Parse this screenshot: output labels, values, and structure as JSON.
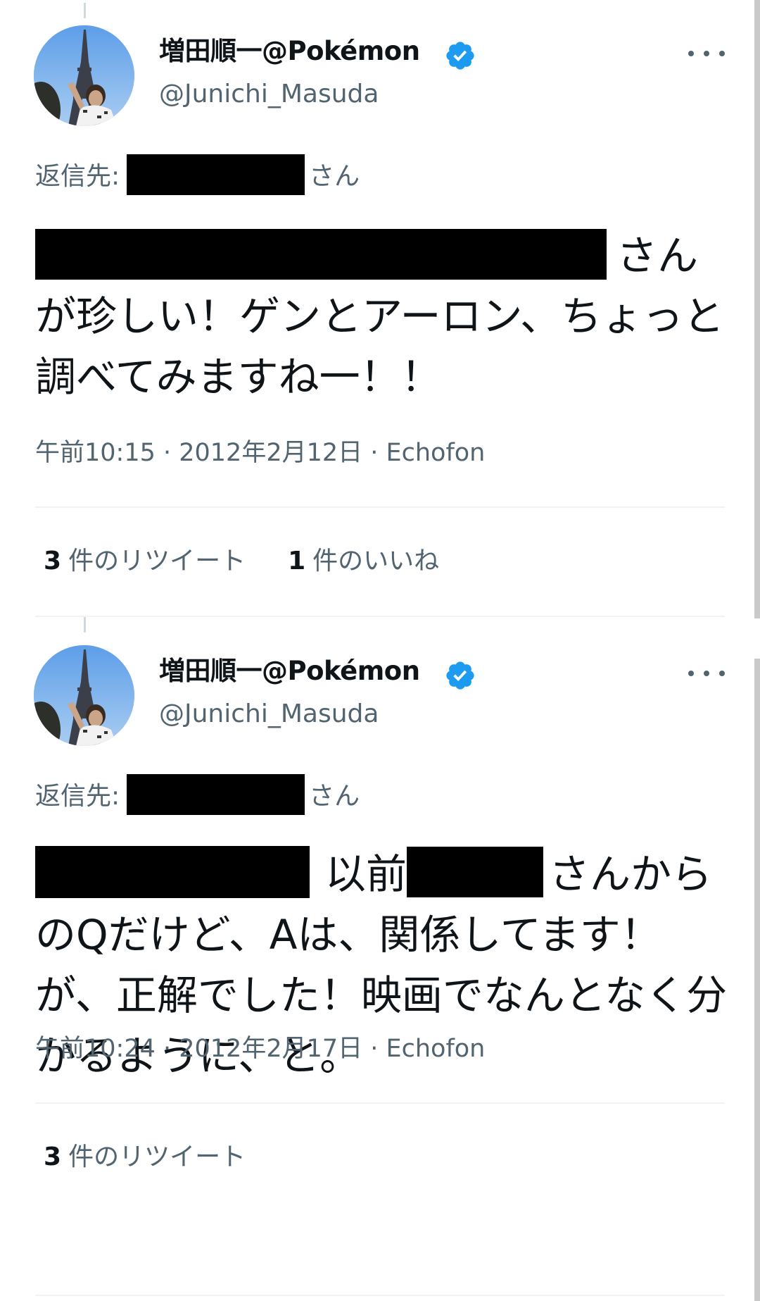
{
  "colors": {
    "text_primary": "#0f1419",
    "text_secondary": "#536471",
    "verified_blue": "#1d9bf0",
    "divider": "#eff3f4",
    "redaction": "#000000"
  },
  "tweets": [
    {
      "display_name": "増田順一@Pokémon",
      "handle": "@Junichi_Masuda",
      "avatar_icon": "avatar-photo-eiffel-tower",
      "verified_icon": "verified-badge-icon",
      "more_icon": "more-options-icon",
      "reply_label": "返信先:",
      "reply_suffix": "さん",
      "body": {
        "segment_after_redaction": "さん",
        "text": "が珍しい！ゲンとアーロン、ちょっと調べてみますね一！！"
      },
      "meta": "午前10:15 · 2012年2月12日 · Echofon",
      "stats": [
        {
          "count": "3",
          "label": "件のリツイート"
        },
        {
          "count": "1",
          "label": "件のいいね"
        }
      ]
    },
    {
      "display_name": "増田順一@Pokémon",
      "handle": "@Junichi_Masuda",
      "avatar_icon": "avatar-photo-eiffel-tower",
      "verified_icon": "verified-badge-icon",
      "more_icon": "more-options-icon",
      "reply_label": "返信先:",
      "reply_suffix": "さん",
      "body": {
        "segment_1": "以前",
        "segment_2": "さんか",
        "text": "らのQだけど、Aは、関係してます！が、正解でした！映画でなんとなく分かるように、と。"
      },
      "meta": "午前10:24 · 2012年2月17日 · Echofon",
      "stats": [
        {
          "count": "3",
          "label": "件のリツイート"
        }
      ]
    }
  ]
}
